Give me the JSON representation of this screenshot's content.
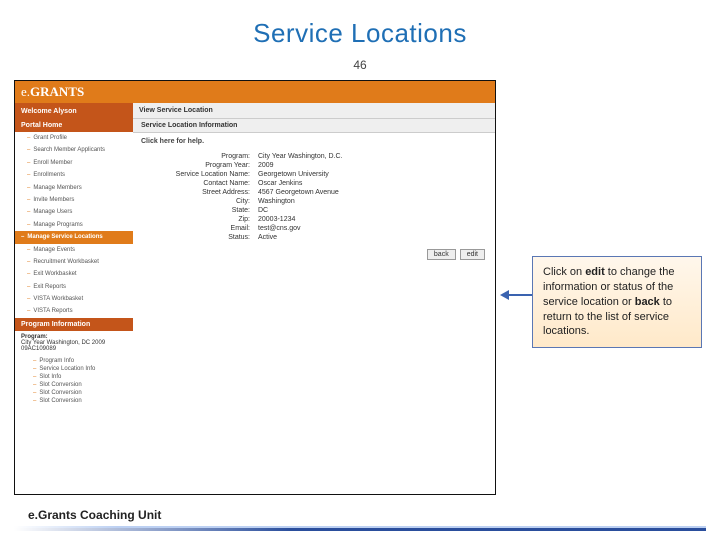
{
  "slide": {
    "title": "Service Locations",
    "number": "46"
  },
  "app": {
    "logo_prefix": "e.",
    "logo_main": "GRANTS",
    "welcome": "Welcome Alyson",
    "viewbar": "View Service Location",
    "sidebar": {
      "portal_head": "Portal Home",
      "items0": [
        "Grant Profile",
        "Search Member Applicants",
        "Enroll Member",
        "Enrollments",
        "Manage Members",
        "Invite Members",
        "Manage Users",
        "Manage Programs"
      ],
      "active": "Manage Service Locations",
      "items1": [
        "Manage Events",
        "Recruitment Workbasket",
        "Exit Workbasket",
        "Exit Reports",
        "VISTA Workbasket",
        "VISTA Reports"
      ],
      "prog_head": "Program Information",
      "program_label": "Program:",
      "program_name": "City Year Washington, DC 2009",
      "program_code": "09AC109089",
      "subs": [
        "Program Info",
        "Service Location Info",
        "Slot Info",
        "Slot Conversion",
        "Slot Conversion",
        "Slot Conversion"
      ]
    },
    "main": {
      "section": "Service Location Information",
      "help": "Click here for help.",
      "fields": [
        {
          "label": "Program:",
          "value": "City Year Washington, D.C."
        },
        {
          "label": "Program Year:",
          "value": "2009"
        },
        {
          "label": "Service Location Name:",
          "value": "Georgetown University"
        },
        {
          "label": "Contact Name:",
          "value": "Oscar Jenkins"
        },
        {
          "label": "Street Address:",
          "value": "4567 Georgetown Avenue"
        },
        {
          "label": "City:",
          "value": "Washington"
        },
        {
          "label": "State:",
          "value": "DC"
        },
        {
          "label": "Zip:",
          "value": "20003-1234"
        },
        {
          "label": "Email:",
          "value": "test@cns.gov"
        },
        {
          "label": "Status:",
          "value": "Active"
        }
      ],
      "back": "back",
      "edit": "edit"
    }
  },
  "callout": {
    "p1a": "Click on ",
    "p1b": "edit",
    "p1c": " to change the information or status of the service location or ",
    "p2a": "back",
    "p2b": " to return to the list of service locations."
  },
  "footer": "e.Grants Coaching Unit"
}
